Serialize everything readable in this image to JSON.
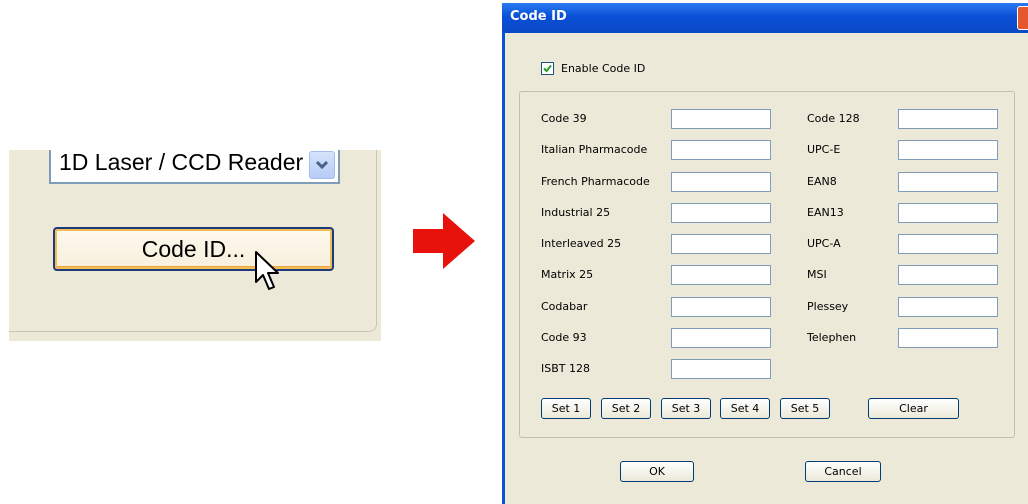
{
  "snippet": {
    "reader_select_value": "1D Laser / CCD Reader",
    "code_id_button_label": "Code ID..."
  },
  "dialog": {
    "title": "Code ID",
    "enable_checkbox_label": "Enable Code ID",
    "enable_checked": true,
    "left_column": [
      "Code 39",
      "Italian Pharmacode",
      "French Pharmacode",
      "Industrial 25",
      "Interleaved 25",
      "Matrix 25",
      "Codabar",
      "Code 93",
      "ISBT 128"
    ],
    "right_column": [
      "Code 128",
      "UPC-E",
      "EAN8",
      "EAN13",
      "UPC-A",
      "MSI",
      "Plessey",
      "Telephen"
    ],
    "set_buttons": [
      "Set 1",
      "Set 2",
      "Set 3",
      "Set 4",
      "Set 5"
    ],
    "clear_button": "Clear",
    "ok_button": "OK",
    "cancel_button": "Cancel"
  },
  "colors": {
    "arrow": "#e8120c",
    "titlebar": "#0a4fd6",
    "dialog_bg": "#ece9d8"
  }
}
